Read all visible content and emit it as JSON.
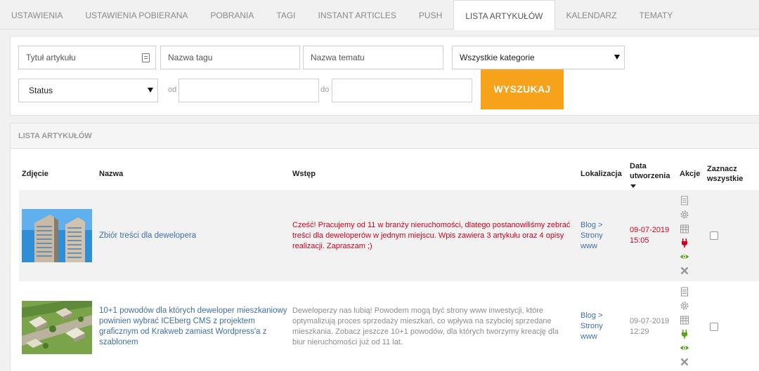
{
  "tabs": [
    {
      "label": "USTAWIENIA",
      "active": false
    },
    {
      "label": "USTAWIENIA POBIERANA",
      "active": false
    },
    {
      "label": "POBRANIA",
      "active": false
    },
    {
      "label": "TAGI",
      "active": false
    },
    {
      "label": "INSTANT ARTICLES",
      "active": false
    },
    {
      "label": "PUSH",
      "active": false
    },
    {
      "label": "LISTA ARTYKUŁÓW",
      "active": true
    },
    {
      "label": "KALENDARZ",
      "active": false
    },
    {
      "label": "TEMATY",
      "active": false
    }
  ],
  "filters": {
    "title_placeholder": "Tytuł artykułu",
    "tag_placeholder": "Nazwa tagu",
    "topic_placeholder": "Nazwa tematu",
    "category_selected": "Wszystkie kategorie",
    "status_selected": "Status",
    "from_label": "od",
    "to_label": "do",
    "search_button": "WYSZUKAJ"
  },
  "list": {
    "header": "LISTA ARTYKUŁÓW",
    "columns": {
      "photo": "Zdjęcie",
      "name": "Nazwa",
      "intro": "Wstęp",
      "location": "Lokalizacja",
      "date_line1": "Data",
      "date_line2": "utworzenia",
      "actions": "Akcje",
      "select_line1": "Zaznacz",
      "select_line2": "wszystkie"
    },
    "rows": [
      {
        "name": "Zbiór treści dla dewelopera",
        "intro": "Cześć! Pracujemy od 11 w branży nieruchomości, dlatego postanowiliśmy zebrać treści dla deweloperów w jednym miejscu. Wpis zawiera 3 artykułu oraz 4 opisy realizacji. Zapraszam ;)",
        "loc1": "Blog >",
        "loc2": "Strony",
        "loc3": "www",
        "date": "09-07-2019",
        "time": "15:05"
      },
      {
        "name": "10+1 powodów dla których deweloper mieszkaniowy powinien wybrać ICEberg CMS z projektem graficznym od Krakweb zamiast Wordpress'a z szablonem",
        "intro": "Deweloperzy nas lubią! Powodem mogą być strony www inwestycji, które optymalizują proces sprzedaży mieszkań, co wpływa na szybciej sprzedane mieszkania. Zobacz jeszcze 10+1 powodów, dla których tworzymy kreację dla biur nieruchomości już od 11 lat.",
        "loc1": "Blog >",
        "loc2": "Strony",
        "loc3": "www",
        "date": "09-07-2019",
        "time": "12:29"
      }
    ]
  },
  "colors": {
    "accent": "#f7a21b",
    "link": "#3f6fa8",
    "red": "#d0021b",
    "green": "#5aa51e"
  },
  "icons": [
    "document-icon",
    "gear-icon",
    "calendar-icon",
    "plug-icon",
    "eye-icon",
    "delete-icon"
  ]
}
